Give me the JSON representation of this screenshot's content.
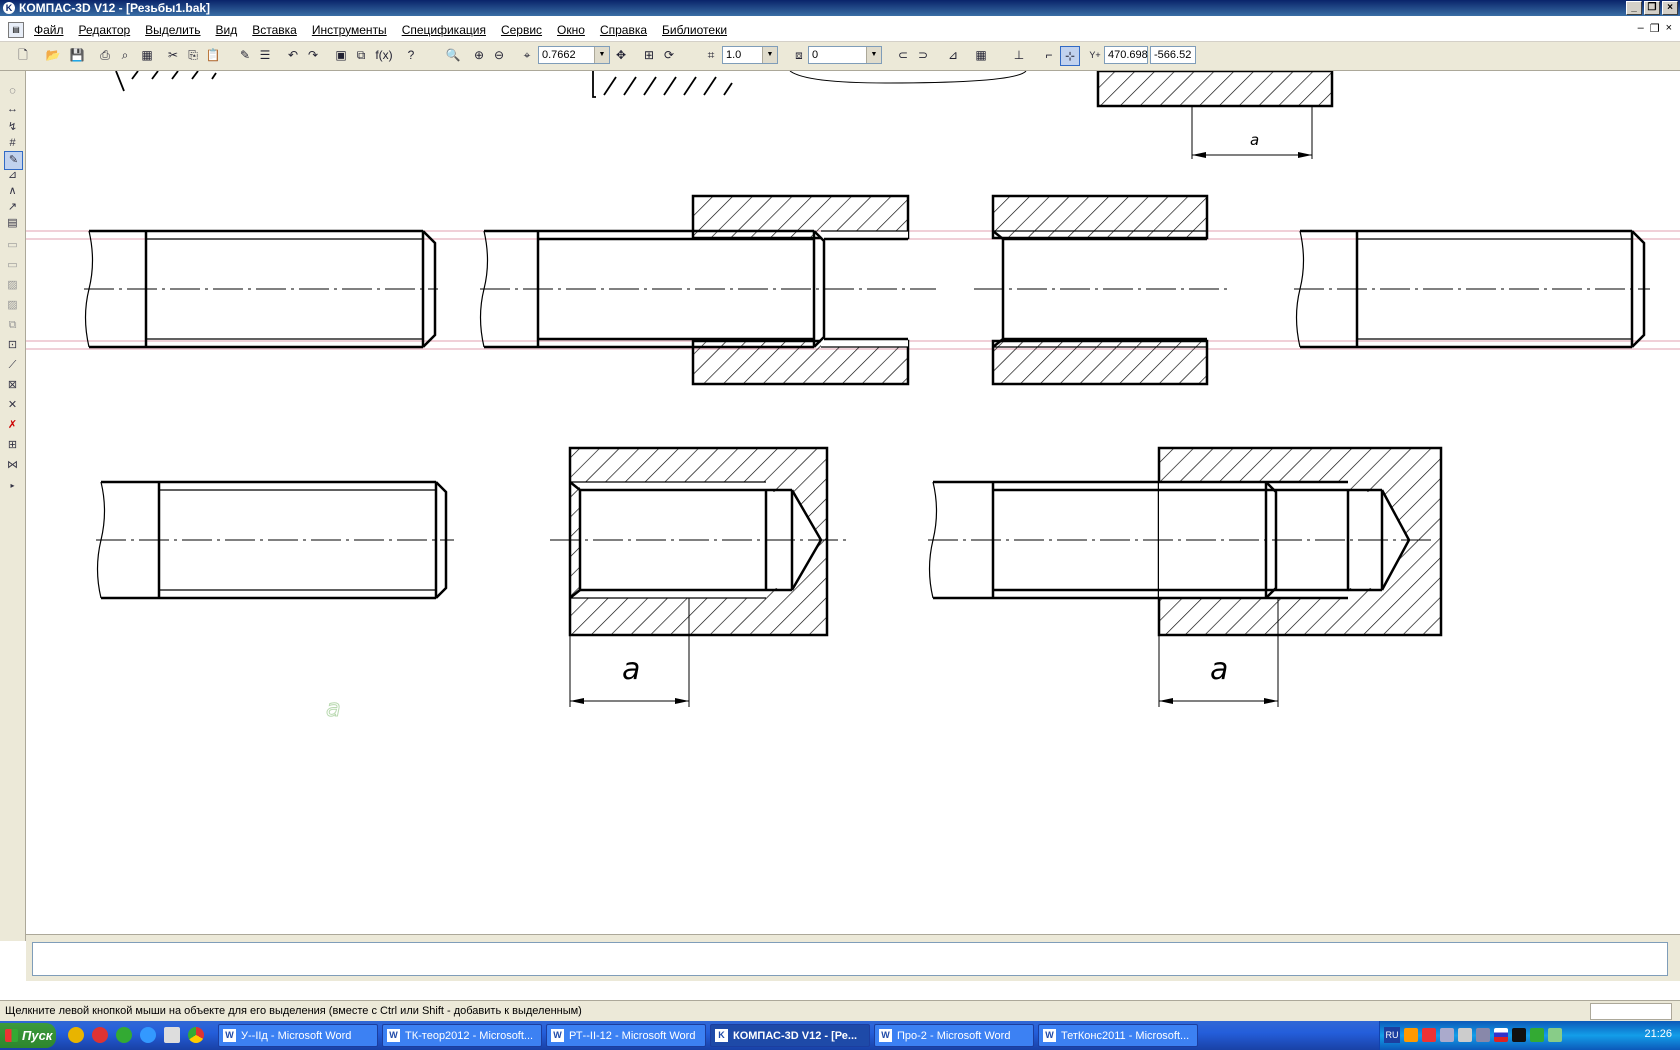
{
  "window": {
    "title": "КОМПАС-3D V12 - [Резьбы1.bak]"
  },
  "menu": {
    "items": [
      "Файл",
      "Редактор",
      "Выделить",
      "Вид",
      "Вставка",
      "Инструменты",
      "Спецификация",
      "Сервис",
      "Окно",
      "Справка",
      "Библиотеки"
    ]
  },
  "toolbar": {
    "zoom": "0.7662",
    "step": "1.0",
    "layer": "0",
    "coord_x": "470.698",
    "coord_y": "-566.52",
    "xy_label": "Y+"
  },
  "drawing": {
    "dim_label_top": "a",
    "dim_label_1": "a",
    "dim_label_2": "a",
    "stray_mark": "a"
  },
  "status": {
    "hint": "Щелкните левой кнопкой мыши на объекте для его выделения (вместе с Ctrl или Shift - добавить к выделенным)"
  },
  "taskbar": {
    "start": "Пуск",
    "tasks": [
      "У--IIд - Microsoft Word",
      "ТК-теор2012 - Microsoft...",
      "РТ--II-12 - Microsoft Word",
      "КОМПАС-3D V12 - [Ре...",
      "Про-2 - Microsoft Word",
      "ТетКонс2011 - Microsoft..."
    ],
    "lang": "RU",
    "clock": "21:26"
  }
}
